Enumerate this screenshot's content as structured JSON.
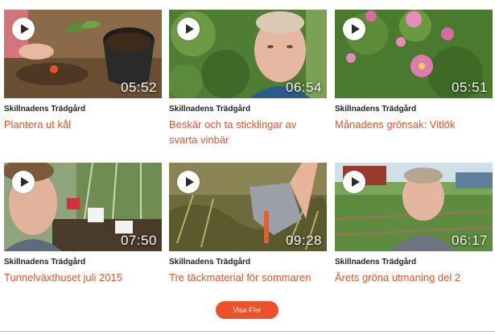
{
  "videos": [
    {
      "channel": "Skillnadens Trädgård",
      "title": "Plantera ut kål",
      "duration": "05:52",
      "thumb": "hands-planting-cabbage"
    },
    {
      "channel": "Skillnadens Trädgård",
      "title": "Beskär och ta sticklingar av svarta vinbär",
      "duration": "06:54",
      "thumb": "woman-by-bush"
    },
    {
      "channel": "Skillnadens Trädgård",
      "title": "Månadens grönsak: Vitlök",
      "duration": "05:51",
      "thumb": "pink-flowers"
    },
    {
      "channel": "Skillnadens Trädgård",
      "title": "Tunnelväxthuset juli 2015",
      "duration": "07:50",
      "thumb": "woman-in-greenhouse"
    },
    {
      "channel": "Skillnadens Trädgård",
      "title": "Tre täckmaterial för sommaren",
      "duration": "09:28",
      "thumb": "gloved-hand-mulch"
    },
    {
      "channel": "Skillnadens Trädgård",
      "title": "Årets gröna utmaning del 2",
      "duration": "06:17",
      "thumb": "woman-in-garden"
    }
  ],
  "show_more_label": "Visa Fler",
  "colors": {
    "accent": "#e8502a",
    "button": "#ee5127",
    "channel_text": "#222222"
  }
}
